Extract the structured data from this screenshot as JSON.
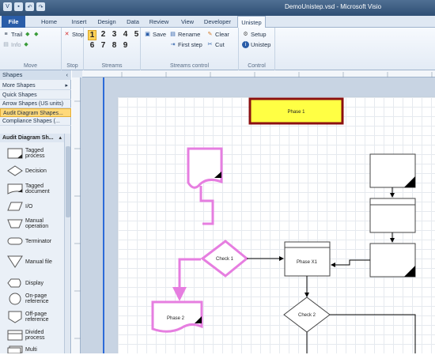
{
  "window": {
    "title": "DemoUnistep.vsd - Microsoft Visio"
  },
  "tabs": [
    "File",
    "Home",
    "Insert",
    "Design",
    "Data",
    "Review",
    "View",
    "Developer",
    "Unistep"
  ],
  "ribbon": {
    "move": {
      "label": "Move",
      "trail": "Trail",
      "info": "Info"
    },
    "stop": {
      "label": "Stop",
      "stop_btn": "Stop"
    },
    "streams": {
      "label": "Streams",
      "row1": [
        "1",
        "2",
        "3",
        "4",
        "5"
      ],
      "row2": [
        "6",
        "7",
        "8",
        "9"
      ],
      "selected": "1"
    },
    "streams_control": {
      "label": "Streams control",
      "save": "Save",
      "rename": "Rename",
      "clear": "Clear",
      "first_step": "First step",
      "cut": "Cut"
    },
    "control": {
      "label": "Control",
      "setup": "Setup",
      "unistep": "Unistep"
    }
  },
  "shapes_pane": {
    "title": "Shapes",
    "more_shapes": "More Shapes",
    "stencils": [
      "Quick Shapes",
      "Arrow Shapes (US units)",
      "Audit Diagram Shapes...",
      "Compliance Shapes (..."
    ],
    "active_stencil": "Audit Diagram Shapes...",
    "stencil_title": "Audit Diagram Sh...",
    "items": [
      "Tagged process",
      "Decision",
      "Tagged document",
      "I/O",
      "Manual operation",
      "Terminator",
      "Manual file",
      "Display",
      "On-page reference",
      "Off-page reference",
      "Divided process",
      "Multi"
    ]
  },
  "diagram": {
    "phase_header": "Phase 1",
    "check1": "Check 1",
    "phase_x1": "Phase X1",
    "check2": "Check 2",
    "phase2": "Phase 2",
    "highlight_color": "#e67ee0",
    "header_fill": "#ffff44",
    "header_border": "#8b1010"
  },
  "colors": {
    "accent": "#2a5da8",
    "guide": "#2d6bd8"
  }
}
